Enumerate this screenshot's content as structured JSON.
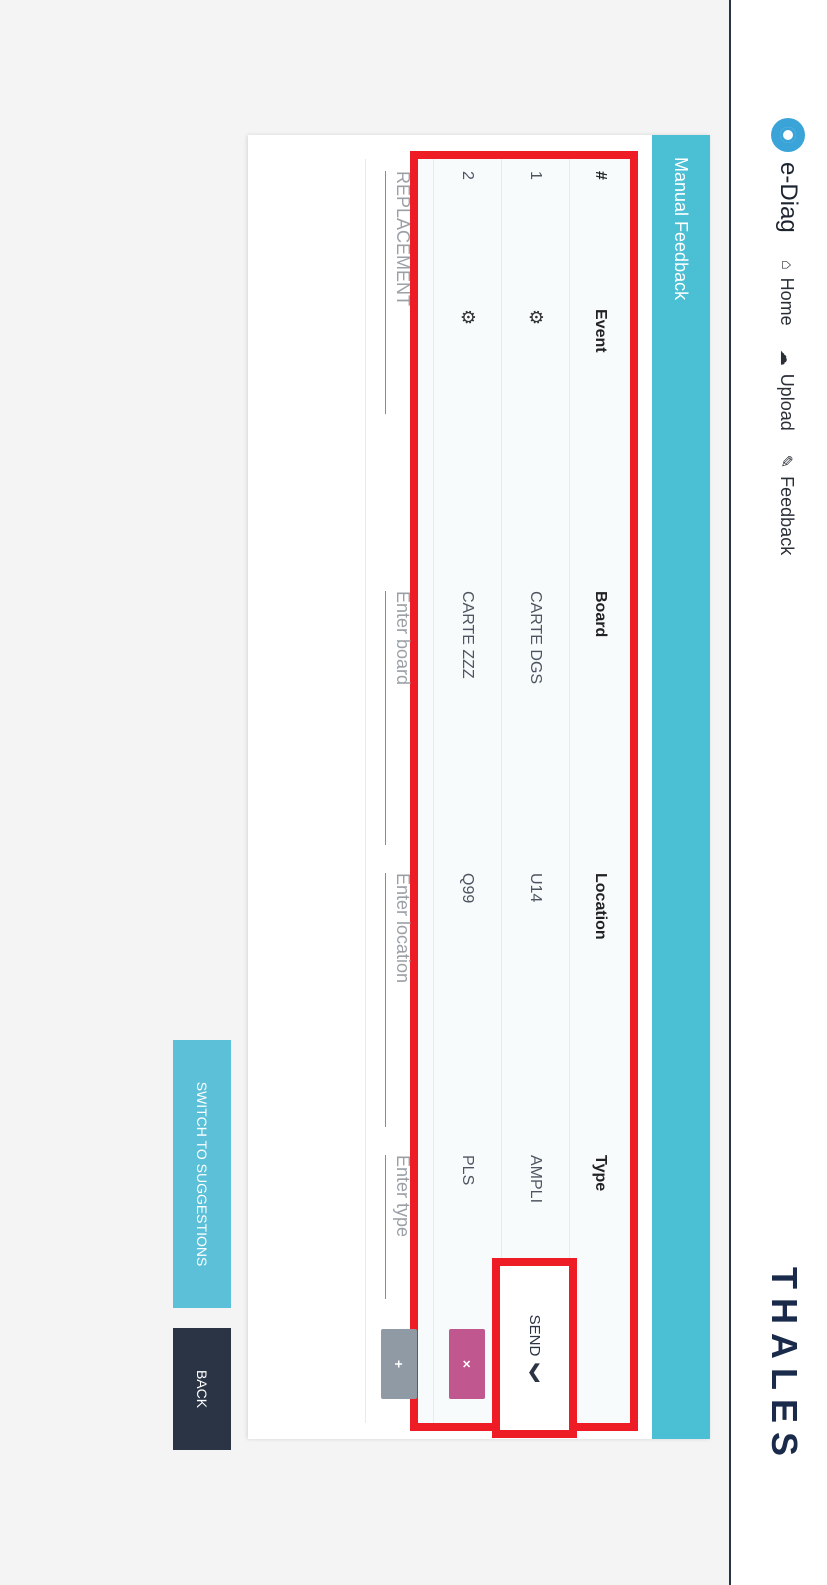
{
  "app": {
    "name": "e-Diag",
    "brand": "THALES",
    "nav": [
      {
        "label": "Home",
        "icon": "home-icon"
      },
      {
        "label": "Upload",
        "icon": "upload-icon"
      },
      {
        "label": "Feedback",
        "icon": "feedback-icon"
      }
    ]
  },
  "card": {
    "title": "Manual Feedback",
    "columns": [
      "#",
      "Event",
      "Board",
      "Location",
      "Type"
    ],
    "rows": [
      {
        "num": "1",
        "board": "CARTE DGS",
        "location": "U14",
        "type": "AMPLI"
      },
      {
        "num": "2",
        "board": "CARTE ZZZ",
        "location": "Q99",
        "type": "PLS"
      }
    ],
    "new_row": {
      "event_placeholder": "REPLACEMENT",
      "board_placeholder": "Enter board",
      "location_placeholder": "Enter location",
      "type_placeholder": "Enter type"
    },
    "remove_label": "×",
    "add_label": "+"
  },
  "actions": {
    "send": "SEND",
    "switch": "SWITCH TO SUGGESTIONS",
    "back": "BACK"
  },
  "colors": {
    "header": "#4bbfd4",
    "remove": "#c0578f",
    "add": "#8f9aa5",
    "highlight": "#ee1c25"
  }
}
